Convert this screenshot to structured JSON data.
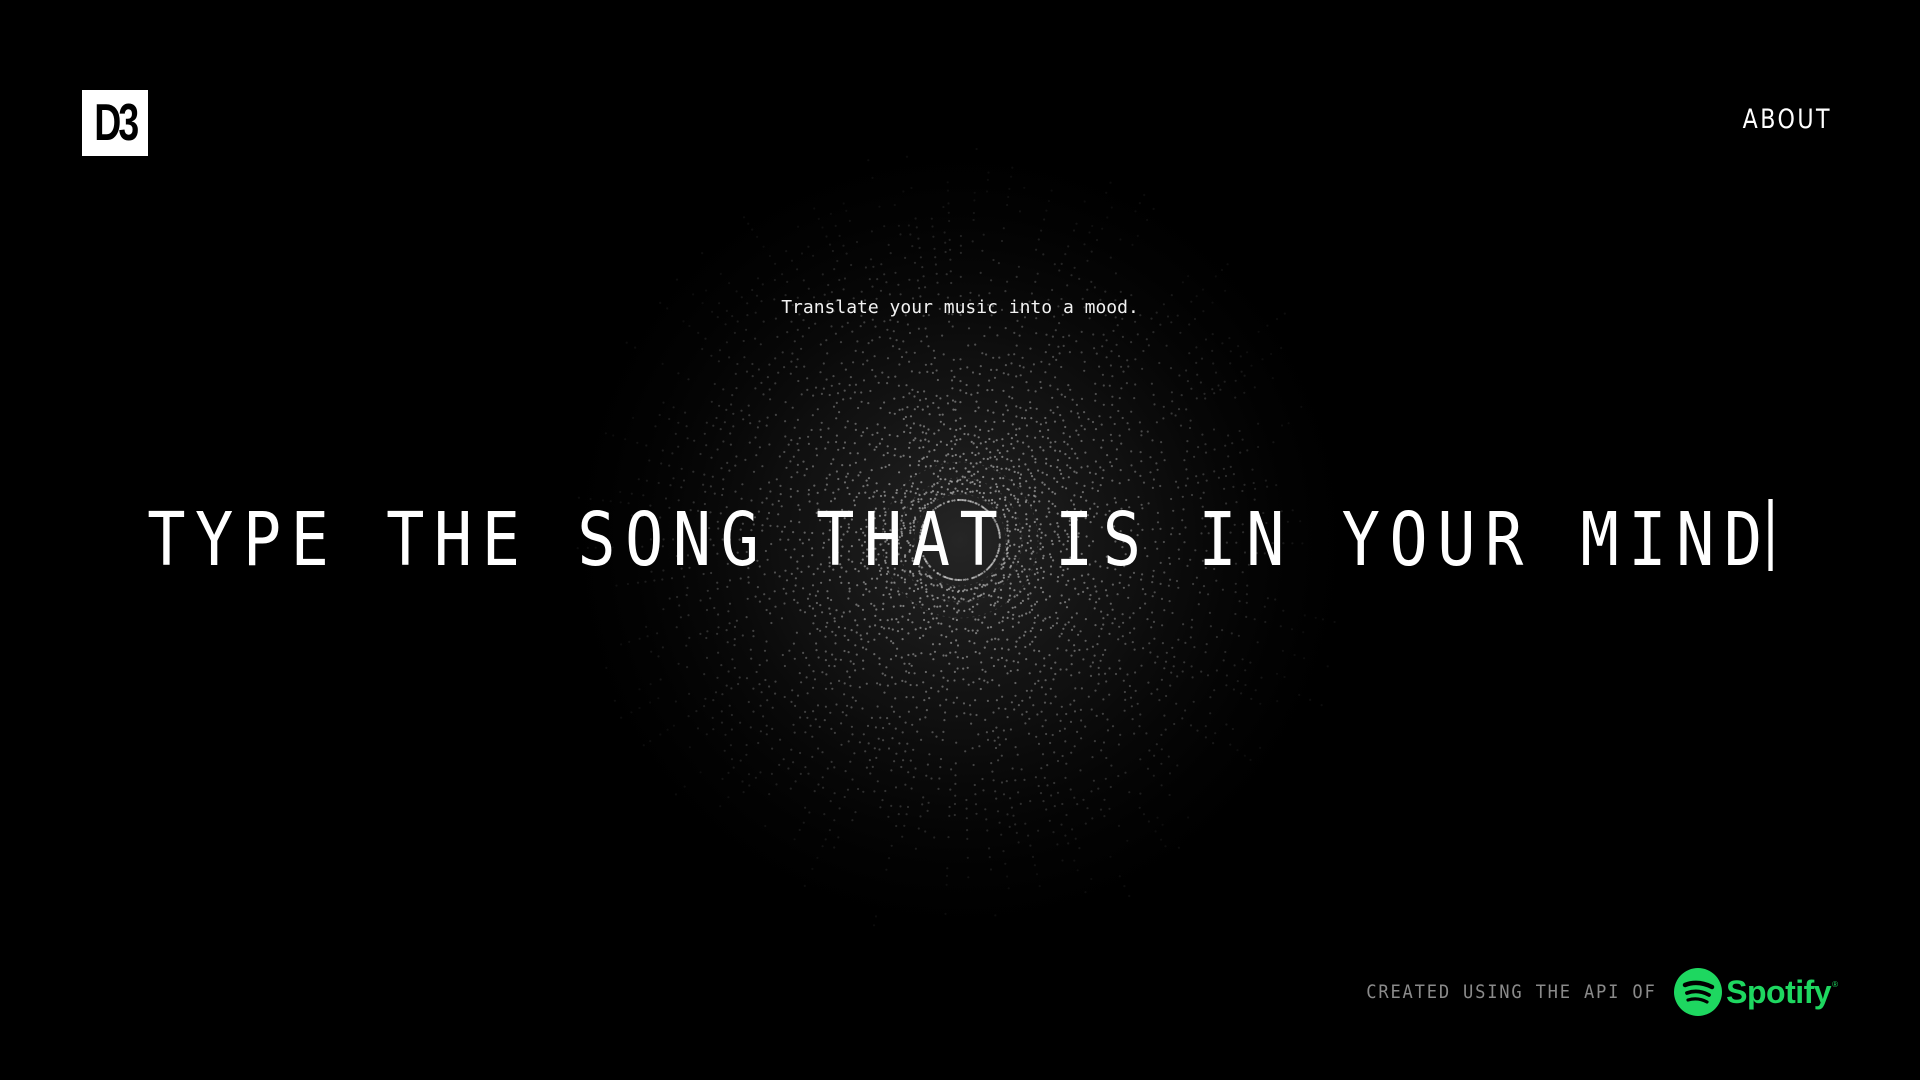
{
  "header": {
    "logo_text": "D3",
    "nav_about": "ABOUT"
  },
  "hero": {
    "tagline": "Translate your music into a mood.",
    "prompt": "TYPE THE SONG THAT IS IN YOUR MIND"
  },
  "footer": {
    "credit_text": "CREATED USING THE API OF",
    "spotify_label": "Spotify",
    "spotify_trademark": "®"
  },
  "colors": {
    "background": "#000000",
    "text": "#ffffff",
    "muted": "#8a8a8a",
    "spotify_green": "#1ed760"
  }
}
